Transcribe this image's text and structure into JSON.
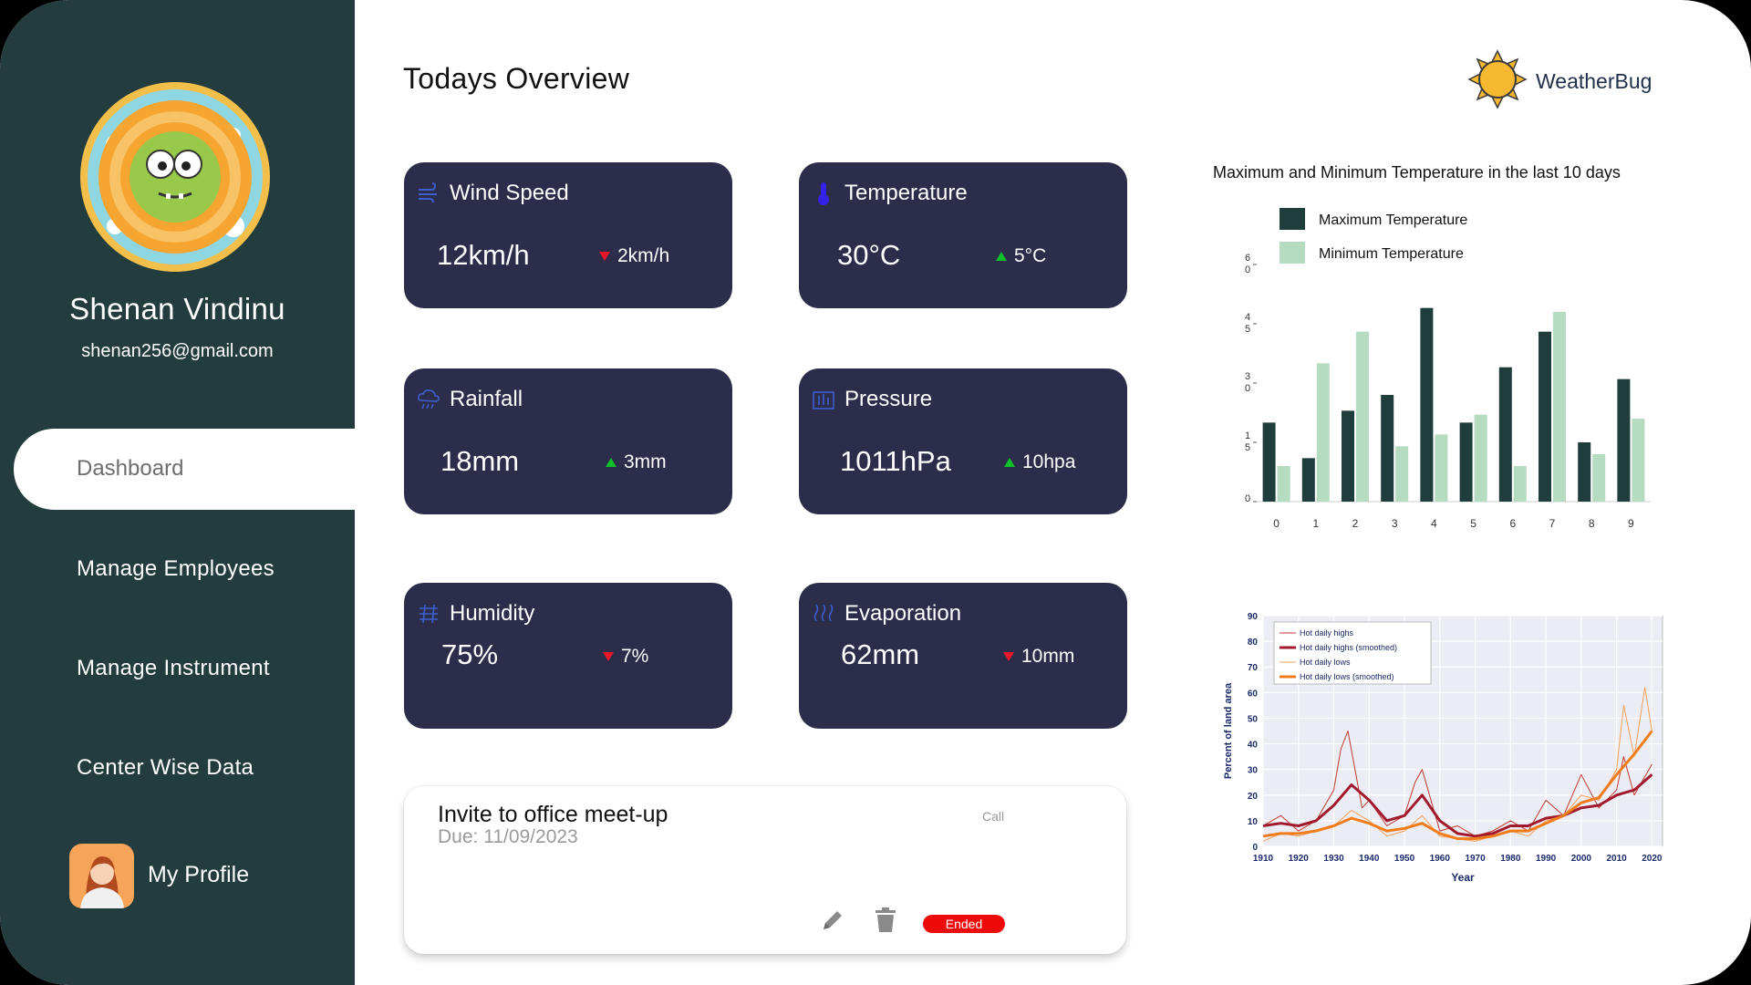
{
  "sidebar": {
    "user_name": "Shenan Vindinu",
    "user_email": "shenan256@gmail.com",
    "nav": [
      {
        "label": "Dashboard"
      },
      {
        "label": "Manage Employees"
      },
      {
        "label": "Manage Instrument"
      },
      {
        "label": "Center Wise Data"
      }
    ],
    "profile_label": "My Profile"
  },
  "header": {
    "title": "Todays Overview",
    "brand": "WeatherBug"
  },
  "cards": [
    {
      "title": "Wind Speed",
      "value": "12km/h",
      "delta": "2km/h",
      "trend": "down",
      "icon": "wind-icon"
    },
    {
      "title": "Temperature",
      "value": "30°C",
      "delta": "5°C",
      "trend": "up",
      "icon": "thermometer-icon"
    },
    {
      "title": "Rainfall",
      "value": "18mm",
      "delta": "3mm",
      "trend": "up",
      "icon": "rain-icon"
    },
    {
      "title": "Pressure",
      "value": "1011hPa",
      "delta": "10hpa",
      "trend": "up",
      "icon": "pressure-icon"
    },
    {
      "title": "Humidity",
      "value": "75%",
      "delta": "7%",
      "trend": "down",
      "icon": "humidity-icon"
    },
    {
      "title": "Evaporation",
      "value": "62mm",
      "delta": "10mm",
      "trend": "down",
      "icon": "evaporation-icon"
    }
  ],
  "task": {
    "title": "Invite to office meet-up",
    "due": "Due: 11/09/2023",
    "type": "Call",
    "status": "Ended"
  },
  "colors": {
    "sidebar": "#233c3e",
    "card": "#2b2d4a",
    "up": "#10c02b",
    "down": "#e8172a",
    "max_temp": "#1f3d3b",
    "min_temp": "#b5dbc0"
  },
  "chart_data": [
    {
      "type": "bar",
      "title": "Maximum and Minimum Temperature in the last 10 days",
      "categories": [
        "0",
        "1",
        "2",
        "3",
        "4",
        "5",
        "6",
        "7",
        "8",
        "9"
      ],
      "series": [
        {
          "name": "Maximum Temperature",
          "values": [
            20,
            11,
            23,
            27,
            49,
            20,
            34,
            43,
            15,
            31
          ]
        },
        {
          "name": "Minimum Temperature",
          "values": [
            9,
            35,
            43,
            14,
            17,
            22,
            9,
            48,
            12,
            21
          ]
        }
      ],
      "y_ticks": [
        {
          "value": 0,
          "label": [
            "0"
          ]
        },
        {
          "value": 15,
          "label": [
            "1",
            "5"
          ]
        },
        {
          "value": 30,
          "label": [
            "3",
            "0"
          ]
        },
        {
          "value": 45,
          "label": [
            "4",
            "5"
          ]
        },
        {
          "value": 60,
          "label": [
            "6",
            "0"
          ]
        }
      ],
      "ylim": [
        0,
        60
      ],
      "legend": "top-left"
    },
    {
      "type": "line",
      "xlabel": "Year",
      "ylabel": "Percent of land area",
      "xlim": [
        1910,
        2023
      ],
      "ylim": [
        0,
        90
      ],
      "x_ticks": [
        1910,
        1920,
        1930,
        1940,
        1950,
        1960,
        1970,
        1980,
        1990,
        2000,
        2010,
        2020
      ],
      "y_ticks": [
        0,
        10,
        20,
        30,
        40,
        50,
        60,
        70,
        80,
        90
      ],
      "legend": "top-left",
      "series": [
        {
          "name": "Hot daily highs",
          "color": "#c0392b",
          "x": [
            1910,
            1915,
            1920,
            1925,
            1930,
            1932,
            1934,
            1936,
            1938,
            1940,
            1945,
            1950,
            1953,
            1955,
            1960,
            1965,
            1970,
            1975,
            1980,
            1985,
            1990,
            1995,
            2000,
            2005,
            2010,
            2012,
            2015,
            2020
          ],
          "y": [
            8,
            12,
            6,
            10,
            22,
            38,
            45,
            30,
            15,
            18,
            8,
            12,
            25,
            30,
            6,
            8,
            4,
            6,
            10,
            6,
            18,
            12,
            28,
            15,
            22,
            35,
            20,
            32
          ]
        },
        {
          "name": "Hot daily highs (smoothed)",
          "color": "#a11a2e",
          "x": [
            1910,
            1915,
            1920,
            1925,
            1930,
            1935,
            1940,
            1945,
            1950,
            1955,
            1960,
            1965,
            1970,
            1975,
            1980,
            1985,
            1990,
            1995,
            2000,
            2005,
            2010,
            2015,
            2020
          ],
          "y": [
            8,
            9,
            8,
            10,
            16,
            24,
            18,
            10,
            12,
            20,
            10,
            5,
            4,
            5,
            8,
            8,
            11,
            12,
            15,
            16,
            20,
            22,
            28
          ]
        },
        {
          "name": "Hot daily lows",
          "color": "#f5a05a",
          "x": [
            1910,
            1915,
            1920,
            1925,
            1930,
            1935,
            1940,
            1945,
            1950,
            1955,
            1960,
            1965,
            1970,
            1975,
            1980,
            1985,
            1990,
            1995,
            2000,
            2005,
            2010,
            2012,
            2015,
            2018,
            2020
          ],
          "y": [
            2,
            5,
            4,
            6,
            8,
            14,
            10,
            4,
            6,
            12,
            4,
            3,
            2,
            4,
            6,
            4,
            10,
            12,
            20,
            18,
            30,
            55,
            35,
            62,
            45
          ]
        },
        {
          "name": "Hot daily lows (smoothed)",
          "color": "#f07c1a",
          "x": [
            1910,
            1915,
            1920,
            1925,
            1930,
            1935,
            1940,
            1945,
            1950,
            1955,
            1960,
            1965,
            1970,
            1975,
            1980,
            1985,
            1990,
            1995,
            2000,
            2005,
            2010,
            2015,
            2020
          ],
          "y": [
            4,
            5,
            5,
            6,
            8,
            11,
            9,
            6,
            7,
            9,
            5,
            3,
            3,
            4,
            6,
            6,
            9,
            12,
            17,
            19,
            28,
            36,
            45
          ]
        }
      ]
    }
  ]
}
